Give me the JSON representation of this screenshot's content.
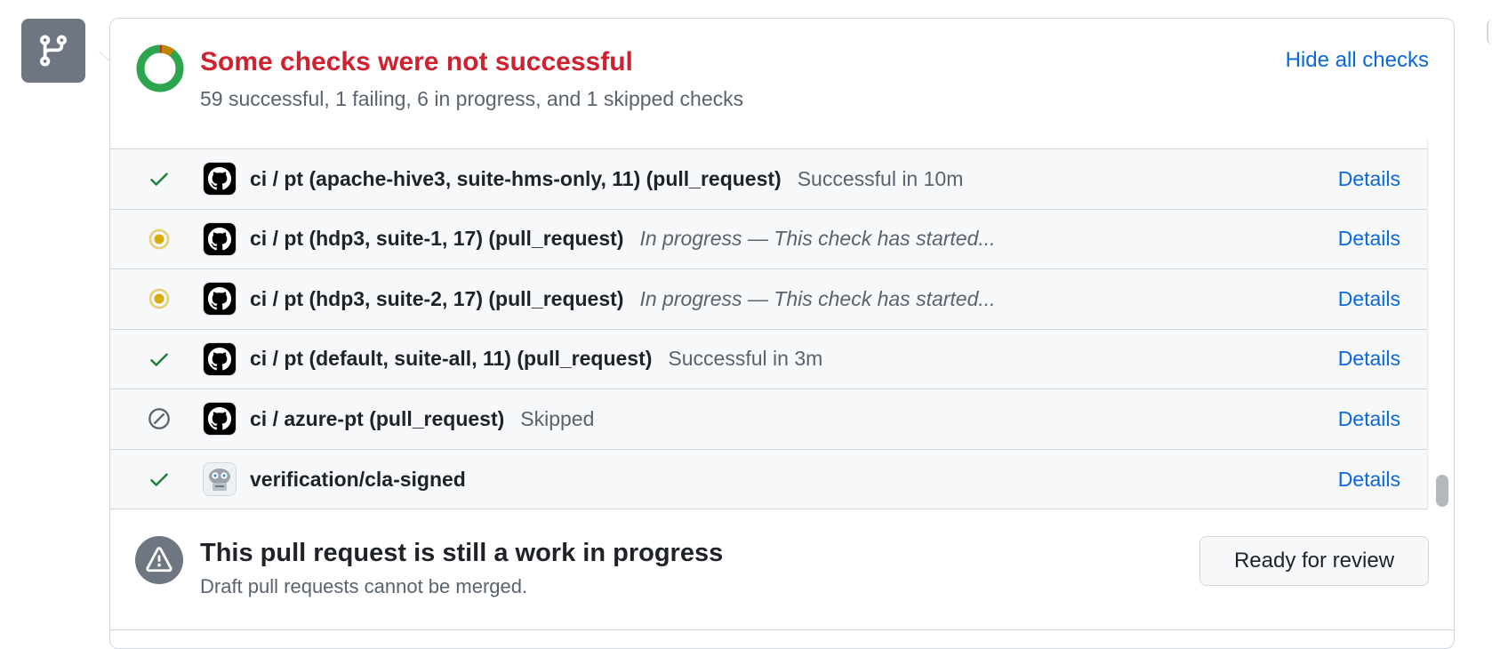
{
  "icons": {
    "gutter": "git-branch-icon",
    "summary": "donut-progress-icon",
    "success": "check-icon",
    "in_progress": "dot-fill-icon",
    "skipped": "skip-icon",
    "github": "github-icon",
    "robot": "robot-avatar-icon",
    "warning": "alert-icon"
  },
  "colors": {
    "danger": "#cf222e",
    "success": "#1a7f37",
    "pending": "#dbab0a",
    "link": "#0969da",
    "muted": "#59636e"
  },
  "summary": {
    "title": "Some checks were not successful",
    "subtitle": "59 successful, 1 failing, 6 in progress, and 1 skipped checks",
    "hide_label": "Hide all checks",
    "counts": {
      "successful": 59,
      "failing": 1,
      "in_progress": 6,
      "skipped": 1
    }
  },
  "checks": [
    {
      "status": "success",
      "avatar": "github",
      "name": "ci / pt (apache-hive3, suite-hms-only, 11) (pull_request)",
      "description": "Successful in 10m",
      "italic": false,
      "details_label": "Details"
    },
    {
      "status": "in_progress",
      "avatar": "github",
      "name": "ci / pt (hdp3, suite-1, 17) (pull_request)",
      "description": "In progress — This check has started...",
      "italic": true,
      "details_label": "Details"
    },
    {
      "status": "in_progress",
      "avatar": "github",
      "name": "ci / pt (hdp3, suite-2, 17) (pull_request)",
      "description": "In progress — This check has started...",
      "italic": true,
      "details_label": "Details"
    },
    {
      "status": "success",
      "avatar": "github",
      "name": "ci / pt (default, suite-all, 11) (pull_request)",
      "description": "Successful in 3m",
      "italic": false,
      "details_label": "Details"
    },
    {
      "status": "skipped",
      "avatar": "github",
      "name": "ci / azure-pt (pull_request)",
      "description": "Skipped",
      "italic": false,
      "details_label": "Details"
    },
    {
      "status": "success",
      "avatar": "robot",
      "name": "verification/cla-signed",
      "description": "",
      "italic": false,
      "details_label": "Details"
    }
  ],
  "merge": {
    "title": "This pull request is still a work in progress",
    "subtitle": "Draft pull requests cannot be merged.",
    "button_label": "Ready for review"
  }
}
